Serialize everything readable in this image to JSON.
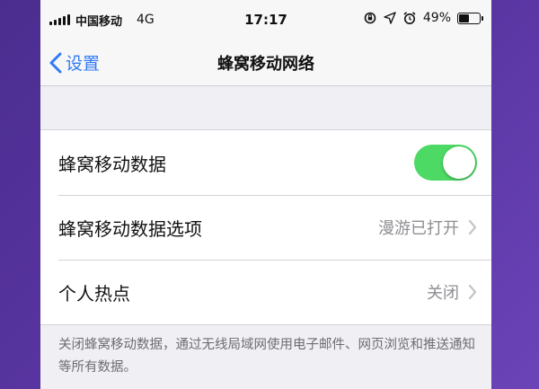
{
  "status_bar": {
    "carrier": "中国移动",
    "network": "4G",
    "time": "17:17",
    "battery_percent": "49%",
    "battery_level": 0.49,
    "icons": [
      "signal-icon",
      "orientation-lock-icon",
      "location-icon",
      "alarm-icon",
      "battery-icon"
    ]
  },
  "nav": {
    "back_label": "设置",
    "title": "蜂窝移动网络"
  },
  "rows": [
    {
      "label": "蜂窝移动数据",
      "control": "toggle",
      "on": true
    },
    {
      "label": "蜂窝移动数据选项",
      "value": "漫游已打开"
    },
    {
      "label": "个人热点",
      "value": "关闭"
    }
  ],
  "footer_note": "关闭蜂窝移动数据，通过无线局域网使用电子邮件、网页浏览和推送通知等所有数据。",
  "colors": {
    "accent": "#2f7bf5",
    "toggle_on": "#4cd964",
    "background": "#efeff4",
    "secondary_text": "#8e8e93"
  }
}
